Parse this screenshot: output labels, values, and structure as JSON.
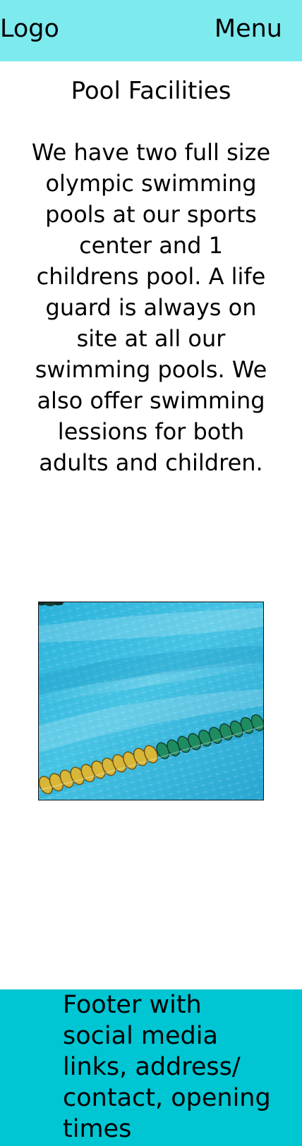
{
  "header": {
    "logo_label": "Logo",
    "menu_label": "Menu",
    "background_color": "#7deaee"
  },
  "main": {
    "title": "Pool Facilities",
    "description": "We have two full size olympic swimming pools at our sports center and 1 childrens pool. A life guard is always on site at all our swimming pools. We also offer swimming lessions for both adults and children.",
    "image": {
      "subject": "swimming pool water with a yellow and green lane divider"
    }
  },
  "footer": {
    "text": "Footer with social media links, address/ contact, opening times",
    "background_color": "#00c5d3"
  }
}
